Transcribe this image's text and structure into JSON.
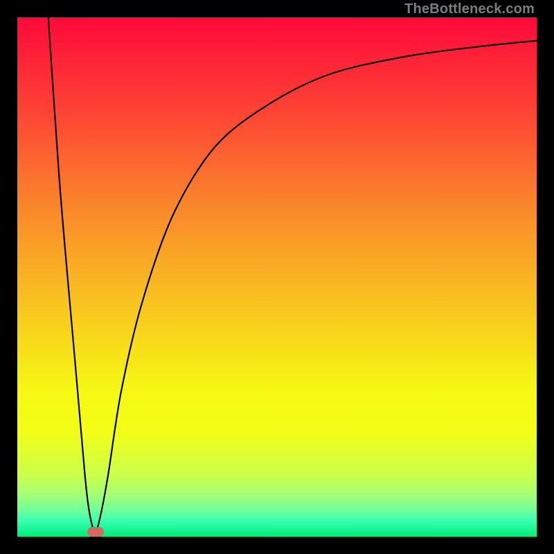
{
  "watermark": "TheBottleneck.com",
  "chart_data": {
    "type": "line",
    "title": "",
    "xlabel": "",
    "ylabel": "",
    "xlim": [
      0,
      100
    ],
    "ylim": [
      0,
      100
    ],
    "curve": {
      "min_x": 15,
      "points": [
        {
          "x": 5,
          "y": 115
        },
        {
          "x": 8,
          "y": 70
        },
        {
          "x": 11,
          "y": 35
        },
        {
          "x": 13,
          "y": 12
        },
        {
          "x": 14,
          "y": 4
        },
        {
          "x": 15,
          "y": 1
        },
        {
          "x": 16,
          "y": 4
        },
        {
          "x": 17.5,
          "y": 12
        },
        {
          "x": 20,
          "y": 28
        },
        {
          "x": 24,
          "y": 45
        },
        {
          "x": 30,
          "y": 62
        },
        {
          "x": 38,
          "y": 75
        },
        {
          "x": 48,
          "y": 83
        },
        {
          "x": 60,
          "y": 89
        },
        {
          "x": 75,
          "y": 92.5
        },
        {
          "x": 90,
          "y": 94.5
        },
        {
          "x": 100,
          "y": 95.5
        }
      ]
    },
    "marker": {
      "x": 15,
      "y": 1,
      "color": "#d46a5f"
    },
    "gradient_stops": [
      {
        "pct": 0,
        "color": "#fe093a"
      },
      {
        "pct": 18,
        "color": "#fd4334"
      },
      {
        "pct": 38,
        "color": "#fa8c2a"
      },
      {
        "pct": 55,
        "color": "#f8c31f"
      },
      {
        "pct": 72,
        "color": "#f6f913"
      },
      {
        "pct": 80,
        "color": "#f2fe17"
      },
      {
        "pct": 88,
        "color": "#ccff4a"
      },
      {
        "pct": 92,
        "color": "#a3ff76"
      },
      {
        "pct": 95,
        "color": "#6dff9d"
      },
      {
        "pct": 97,
        "color": "#36ffb0"
      },
      {
        "pct": 100,
        "color": "#00ed78"
      }
    ]
  }
}
